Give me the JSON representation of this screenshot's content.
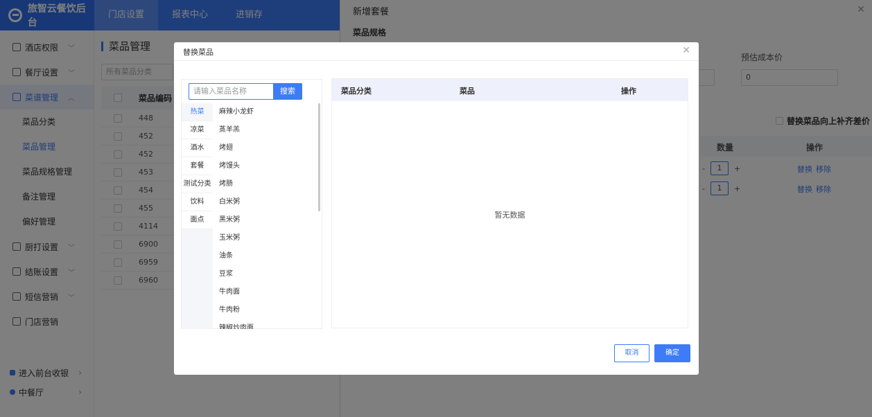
{
  "app": {
    "logo_text": "旅智云餐饮后台"
  },
  "topnav": [
    "门店设置",
    "报表中心",
    "进销存"
  ],
  "sidebar": {
    "items": [
      {
        "label": "酒店权限",
        "icon": "hotel-icon"
      },
      {
        "label": "餐厅设置",
        "icon": "home-icon"
      },
      {
        "label": "菜谱管理",
        "icon": "grid-icon"
      }
    ],
    "sub_items": [
      "菜品分类",
      "菜品管理",
      "菜品规格管理",
      "备注管理",
      "偏好管理"
    ],
    "items2": [
      {
        "label": "厨打设置",
        "icon": "printer-icon"
      },
      {
        "label": "结账设置",
        "icon": "checkout-icon"
      },
      {
        "label": "短信营销",
        "icon": "mail-icon"
      },
      {
        "label": "门店营销",
        "icon": "store-icon"
      }
    ],
    "bottom": [
      "进入前台收银",
      "中餐厅"
    ]
  },
  "content": {
    "title": "菜品管理",
    "filter_placeholder": "所有菜品分类",
    "table_header": "菜品编码",
    "codes": [
      "448",
      "452",
      "452",
      "453",
      "454",
      "455",
      "4114",
      "6900",
      "6959",
      "6960"
    ]
  },
  "drawer": {
    "title": "新增套餐",
    "section": "菜品规格",
    "cost_label": "预估成本价",
    "cost_value": "0",
    "checkbox_label": "替换菜品向上补齐差价",
    "col_qty": "数量",
    "col_action": "操作",
    "rows": [
      {
        "qty": "1",
        "replace": "替换",
        "remove": "移除"
      },
      {
        "qty": "1",
        "replace": "替换",
        "remove": "移除"
      }
    ]
  },
  "modal": {
    "title": "替换菜品",
    "search_placeholder": "请输入菜品名称",
    "search_button": "搜索",
    "categories": [
      "热菜",
      "凉菜",
      "酒水",
      "套餐",
      "测试分类",
      "饮料",
      "面点"
    ],
    "dishes": [
      "麻辣小龙虾",
      "蒸羊羔",
      "烤翅",
      "烤馒头",
      "烤肠",
      "白米粥",
      "黑米粥",
      "玉米粥",
      "油条",
      "豆浆",
      "牛肉面",
      "牛肉粉",
      "辣椒炒肉面"
    ],
    "table_headers": [
      "菜品分类",
      "菜品",
      "操作"
    ],
    "empty_text": "暂无数据",
    "cancel": "取消",
    "confirm": "确定"
  },
  "colors": {
    "primary": "#3d7bf7"
  }
}
